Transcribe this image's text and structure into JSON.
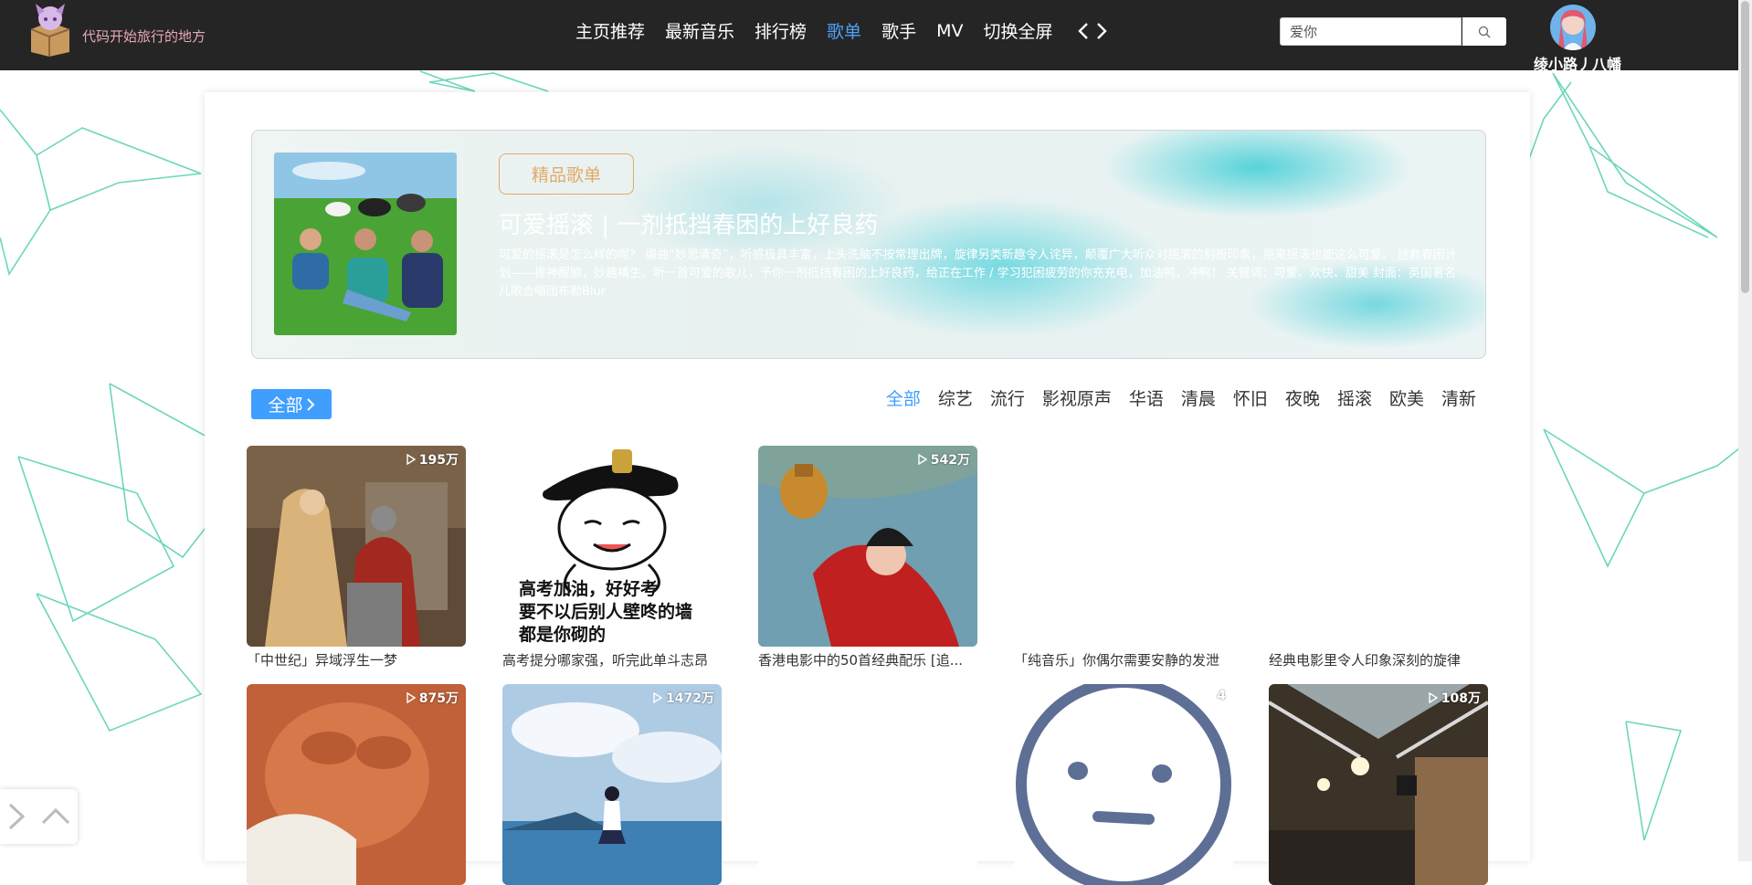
{
  "site": {
    "name": "代码开始旅行的地方"
  },
  "nav": {
    "items": [
      {
        "label": "主页推荐"
      },
      {
        "label": "最新音乐"
      },
      {
        "label": "排行榜"
      },
      {
        "label": "歌单"
      },
      {
        "label": "歌手"
      },
      {
        "label": "MV"
      },
      {
        "label": "切换全屏"
      }
    ],
    "active_index": 3
  },
  "search": {
    "value": "爱你"
  },
  "user": {
    "name": "绫小路丿八幡"
  },
  "banner": {
    "tag": "精品歌单",
    "title": "可爱摇滚 | 一剂抵挡春困的上好良药",
    "description": "可爱的摇滚是怎么样的呢？ 编曲“妙思清奇”，听感极具丰富，上头洗脑不按常理出牌，旋律另类新趣令人诧异，颠覆广大听众对摇滚的刻板印象，原来摇滚也能这么可爱。 拯救春困计划——提神醒脑，妙趣横生。听一首可爱的歌儿，予你一剂抵挡春困的上好良药，给正在工作 / 学习犯困疲劳的你充充电，加油鸭，冲鸭！ 关键词：可爱、欢快、甜美 封面：英国著名儿歌合唱团布勒Blur"
  },
  "categories": {
    "all_label": "全部",
    "tags": [
      "全部",
      "综艺",
      "流行",
      "影视原声",
      "华语",
      "清晨",
      "怀旧",
      "夜晚",
      "摇滚",
      "欧美",
      "清新"
    ],
    "active_index": 0
  },
  "playlists": [
    {
      "title": "「中世纪」异域浮生一梦",
      "plays": "195万"
    },
    {
      "title": "高考提分哪家强，听完此单斗志昂",
      "plays": ""
    },
    {
      "title": "香港电影中的50首经典配乐 [追...",
      "plays": "542万"
    },
    {
      "title": "「纯音乐」你偶尔需要安静的发泄",
      "plays": ""
    },
    {
      "title": "经典电影里令人印象深刻的旋律",
      "plays": ""
    },
    {
      "title": "",
      "plays": "875万"
    },
    {
      "title": "",
      "plays": "1472万"
    },
    {
      "title": "",
      "plays": ""
    },
    {
      "title": "",
      "plays": "4"
    },
    {
      "title": "",
      "plays": "108万"
    }
  ],
  "meme": {
    "line1": "高考加油，好好考",
    "line2": "要不以后别人壁咚的墙",
    "line3": "都是你砌的"
  },
  "colors": {
    "topbar": "#252525",
    "accent": "#409eff",
    "nav_active": "#4fa1f5",
    "tag_border": "#e2a96a",
    "network": "#3cc8a8"
  },
  "icons": [
    "logo-icon",
    "chevron-left-icon",
    "chevron-right-icon",
    "search-icon",
    "play-icon",
    "collapse-icon",
    "back-to-top-icon"
  ]
}
